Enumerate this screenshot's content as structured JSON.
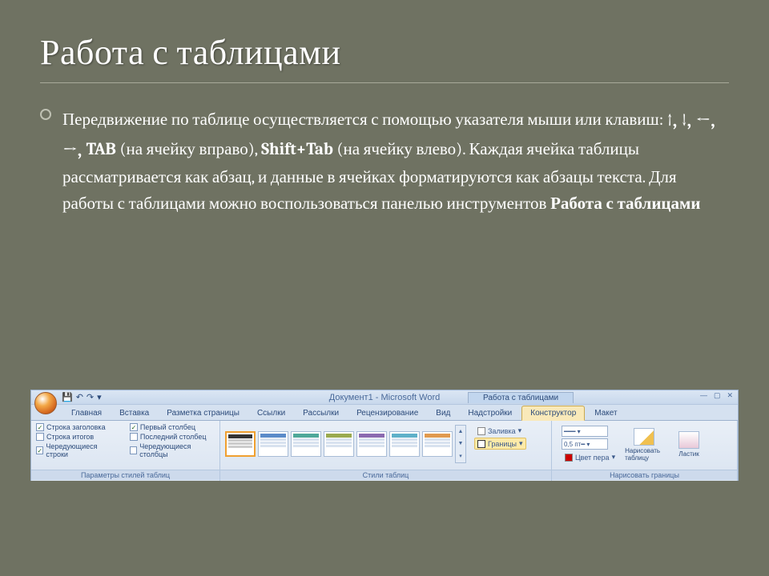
{
  "title": "Работа с таблицами",
  "body": {
    "pre": "Передвижение по таблице осуществляется с помощью указателя мыши или клавиш: ",
    "arrows": "↑, ↓, ←, →, ",
    "tab_key": "TAB",
    "tab_desc": " (на ячейку вправо), ",
    "shift_tab": "Shift+Tab",
    "shift_desc": " (на ячейку влево). Каждая ячейка таблицы рассматривается как абзац, и данные в ячейках форматируются как абзацы текста. Для работы с таблицами можно воспользоваться панелью инструментов ",
    "panel_name": "Работа с таблицами"
  },
  "ribbon": {
    "doc_title": "Документ1 - Microsoft Word",
    "tool_context": "Работа с таблицами",
    "tabs": [
      "Главная",
      "Вставка",
      "Разметка страницы",
      "Ссылки",
      "Рассылки",
      "Рецензирование",
      "Вид",
      "Надстройки",
      "Конструктор",
      "Макет"
    ],
    "active_tab": "Конструктор",
    "groups": {
      "style_options": {
        "label": "Параметры стилей таблиц",
        "col1": [
          {
            "label": "Строка заголовка",
            "checked": true
          },
          {
            "label": "Строка итогов",
            "checked": false
          },
          {
            "label": "Чередующиеся строки",
            "checked": true
          }
        ],
        "col2": [
          {
            "label": "Первый столбец",
            "checked": true
          },
          {
            "label": "Последний столбец",
            "checked": false
          },
          {
            "label": "Чередующиеся столбцы",
            "checked": false
          }
        ]
      },
      "styles": {
        "label": "Стили таблиц",
        "shading": "Заливка",
        "borders": "Границы"
      },
      "draw": {
        "label": "Нарисовать границы",
        "width": "0,5 пт",
        "pen_color": "Цвет пера",
        "draw_table": "Нарисовать таблицу",
        "eraser": "Ластик"
      }
    }
  }
}
